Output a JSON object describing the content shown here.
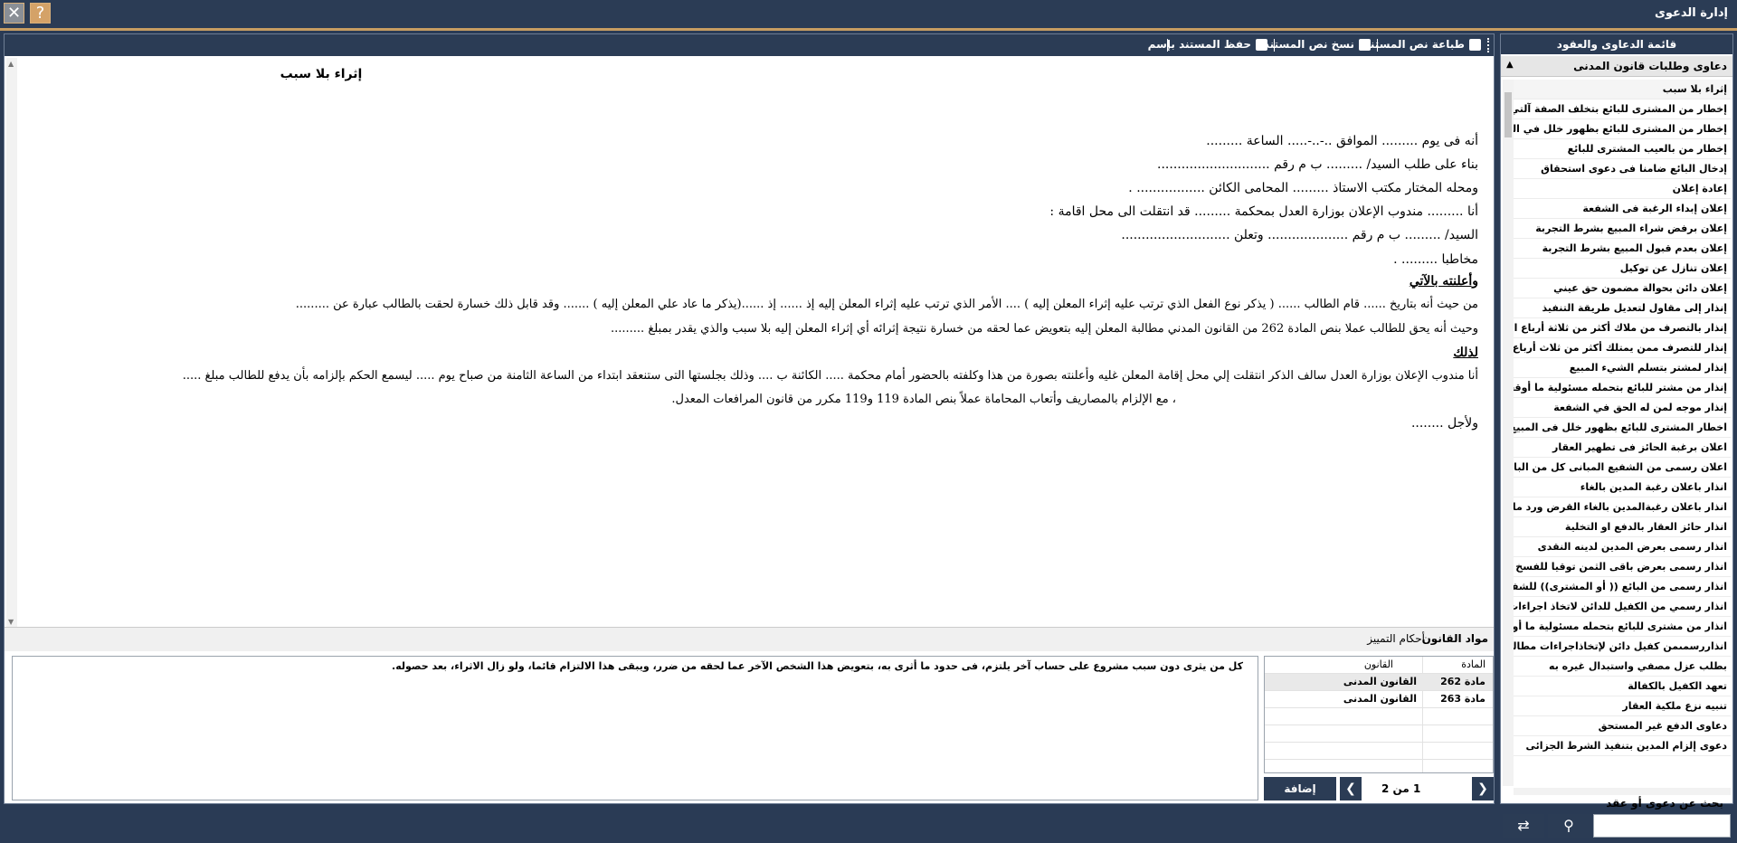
{
  "window": {
    "title": "إدارة الدعوى",
    "close_glyph": "✕",
    "help_glyph": "?"
  },
  "toolbar": {
    "print_label": "طباعة نص المستند",
    "copy_label": "نسخ نص المستند",
    "save_as_label": "حفظ المستند بإسم"
  },
  "document": {
    "title": "إثراء بلا سبب",
    "lines": [
      "أنه فى يوم ......... الموافق ..-..-..... الساعة .........",
      "بناء على طلب السيد/ ......... ب م رقم ............................",
      "ومحله المختار مكتب الاستاذ ......... المحامى الكائن ................. .",
      "أنا ......... مندوب الإعلان بوزارة العدل بمحكمة ......... قد انتقلت الى محل اقامة :",
      "السيد/ ......... ب م رقم .................... وتعلن ...........................",
      "مخاطبا ......... .",
      "وأعلنته بالآتي",
      "من حيث أنه بتاريخ ...... قام الطالب ...... ( يذكر نوع الفعل الذي ترتب عليه إثراء المعلن إليه ) .... الأمر الذي ترتب عليه إثراء المعلن إليه إذ ...... إذ ......(يذكر ما عاد علي المعلن إليه ) ....... وقد قابل ذلك خسارة لحقت بالطالب عبارة عن .........",
      "وحيث أنه يحق للطالب عملا بنص المادة 262 من القانون المدني مطالبة المعلن إليه بتعويض عما لحقه من خسارة نتيجة إثرائه أي إثراء المعلن إليه بلا سبب والذي يقدر بمبلغ .........",
      "لذلك",
      "أنا مندوب الإعلان بوزارة العدل سالف الذكر انتقلت إلي محل إقامة المعلن غليه وأعلنته بصورة من هذا وكلفته بالحضور أمام محكمة ..... الكائنة ب .... وذلك بجلستها التى ستنعقد ابتداء من الساعة الثامنة من صباح يوم ..... ليسمع الحكم بإلزامه بأن يدفع للطالب مبلغ .....",
      "، مع الإلزام بالمصاريف وأتعاب المحاماة عملاً بنص المادة 119 و119 مكرر من قانون المرافعات المعدل.",
      "ولأجل ........"
    ]
  },
  "tabs": {
    "law_articles": "مواد القانون",
    "cassation_rulings": "أحكام التمييز"
  },
  "definition_text": "كل من يثرى دون سبب مشروع على حساب آخر يلتزم، فى حدود ما أثرى به، بتعويض هذا الشخص الآخر عما لحقه من ضرر، ويبقى هذا الالتزام قائما، ولو زال الاثراء، بعد حصوله.",
  "law_table": {
    "headers": {
      "article": "المادة",
      "law": "القانون"
    },
    "rows": [
      {
        "article": "مادة 262",
        "law": "القانون المدنى"
      },
      {
        "article": "مادة 263",
        "law": "القانون المدنى"
      }
    ]
  },
  "pager": {
    "page_text": "1 من 2",
    "add_label": "إضافة",
    "next_glyph": "❯",
    "prev_glyph": "❮"
  },
  "sidebar": {
    "header": "قائمة الدعاوى والعقود",
    "group_label": "دعاوى وطلبات قانون المدنى",
    "group_chevron": "▲",
    "items": [
      "إثراء بلا سبب",
      "إخطار من المشترى للبائع بتخلف الصفة آلتي كف",
      "إخطار من المشترى للبائع بظهور خلل في المبيع",
      "إخطار من بالعيب المشترى للبائع",
      "إدخال البائع ضامنا فى دعوى استحقاق",
      "إعادة إعلان",
      "إعلان إبداء الرغبة فى الشفعة",
      "إعلان برفض شراء المبيع بشرط التجربة",
      "إعلان بعدم قبول المبيع بشرط التجربة",
      "إعلان تنازل عن توكيل",
      "إعلان دائن بحوالة مضمون حق عيني",
      "إنذار إلى مقاول لتعديل طريقة التنفيذ",
      "إنذار بالتصرف من ملاك أكثر من ثلاثة أرباع الم",
      "إنذار للتصرف ممن يمتلك أكثر من ثلاث أرباع الم",
      "إنذار لمشتر بتسلم الشيء المبيع",
      "إنذار من مشتر للبائع بتحمله مسئولية ما أوقعه",
      "إنذار موجه لمن له الحق في الشفعة",
      "اخطار المشترى للبائع بظهور خلل فى المبيع",
      "اعلان برغبة الحائز فى تطهير العقار",
      "اعلان رسمى من الشفيع المبانى كل من البائع و",
      "انذار باعلان رغبة المدين بالغاء",
      "انذار باعلان رغبةالمدين بالغاء القرض ورد ما ا",
      "انذار حائز العقار بالدفع او التخلية",
      "انذار رسمى بعرض المدين لدينه النقدى",
      "انذار رسمى بعرض باقى الثمن توقيا للفسخ",
      "انذار رسمى من البائع (( أو المشترى)) للشفيع",
      "انذار رسمي من الكفيل للدائن لاتخاذ اجراءات",
      "انذار من مشترى للبائع بتحمله مسئولية ما أوقع",
      "انذاررسمىمن كفيل دائن لإتخاذاجراءات مطالبته",
      "بطلب عزل مصفي واستبدال غيره به",
      "تعهد الكفيل بالكفالة",
      "تنبيه نزع ملكية العقار",
      "دعاوى الدفع غير المستحق",
      "دعوى إلزام المدين بتنفيذ الشرط الجزائى"
    ],
    "search_label": "بحث عن دعوى أو عقد",
    "search_glyph": "⚲",
    "refresh_glyph": "⇄"
  }
}
